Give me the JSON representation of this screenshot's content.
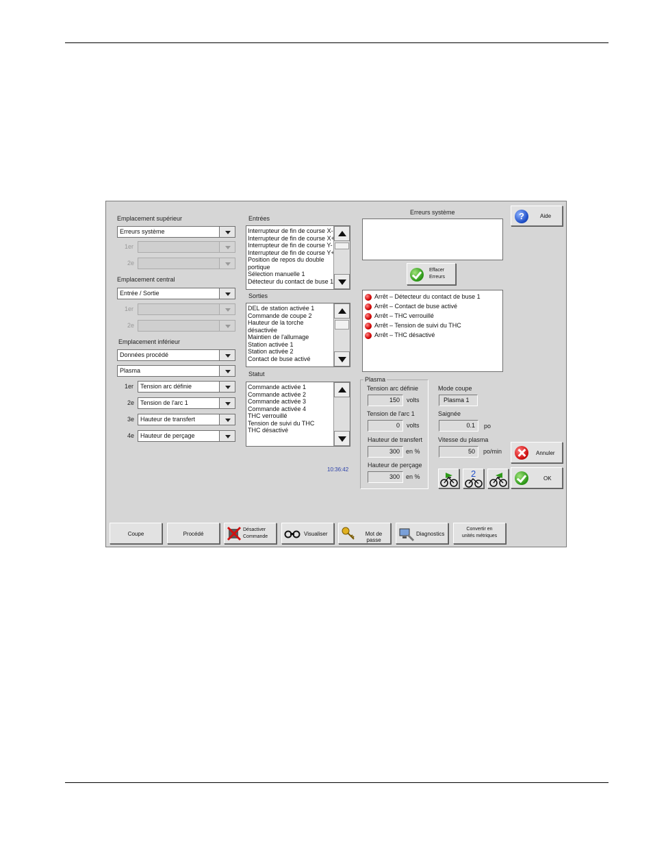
{
  "colors": {
    "panel_bg": "#d6d6d6",
    "time_text": "#2a3fa8",
    "error_dot": "#d00000",
    "accent_green": "#2f9a1a",
    "accent_red": "#d01010",
    "accent_blue": "#1f4fc8"
  },
  "left": {
    "upper_location": {
      "label": "Emplacement supérieur",
      "value": "Erreurs système",
      "sub1_label": "1er",
      "sub2_label": "2e"
    },
    "center_location": {
      "label": "Emplacement central",
      "value": "Entrée / Sortie",
      "sub1_label": "1er",
      "sub2_label": "2e"
    },
    "lower_location": {
      "label": "Emplacement inférieur",
      "value": "Données procédé",
      "process": "Plasma",
      "rows": [
        {
          "label": "1er",
          "value": "Tension arc définie"
        },
        {
          "label": "2e",
          "value": "Tension de l'arc 1"
        },
        {
          "label": "3e",
          "value": "Hauteur de transfert"
        },
        {
          "label": "4e",
          "value": "Hauteur de perçage"
        }
      ]
    }
  },
  "middle": {
    "inputs": {
      "label": "Entrées",
      "items": [
        "Interrupteur de fin de course X-",
        "Interrupteur de fin de course X+",
        "Interrupteur de fin de course Y-",
        "Interrupteur de fin de course Y+",
        "Position de repos du double",
        "portique",
        "Sélection manuelle 1",
        "Détecteur du contact de buse 1"
      ]
    },
    "outputs": {
      "label": "Sorties",
      "items": [
        "DEL de station activée 1",
        "Commande de coupe 2",
        "Hauteur de la torche",
        "désactivée",
        "Maintien de l'allumage",
        "Station activée 1",
        "Station activée 2",
        "Contact de buse activé"
      ]
    },
    "status": {
      "label": "Statut",
      "items": [
        "Commande activée 1",
        "Commande activée 2",
        "Commande activée 3",
        "Commande activée 4",
        "THC verrouillé",
        "Tension de suivi du THC",
        "THC désactivé"
      ]
    },
    "time": "10:36:42"
  },
  "right": {
    "system_errors_title": "Erreurs système",
    "clear_errors": {
      "line1": "Effacer",
      "line2": "Erreurs"
    },
    "error_list": [
      "Arrêt – Détecteur du contact de buse 1",
      "Arrêt – Contact de buse activé",
      "Arrêt – THC verrouillé",
      "Arrêt – Tension de suivi du THC",
      "Arrêt – THC désactivé"
    ],
    "plasma": {
      "title": "Plasma",
      "fields": [
        {
          "label": "Tension arc définie",
          "value": "150",
          "unit": "volts"
        },
        {
          "label": "Tension de l'arc 1",
          "value": "0",
          "unit": "volts"
        },
        {
          "label": "Hauteur de transfert",
          "value": "300",
          "unit": "en %"
        },
        {
          "label": "Hauteur de perçage",
          "value": "300",
          "unit": "en %"
        }
      ]
    },
    "cut_mode": {
      "label": "Mode coupe",
      "value": "Plasma 1"
    },
    "kerf": {
      "label": "Saignée",
      "value": "0.1",
      "unit": "po"
    },
    "plasma_speed": {
      "label": "Vitesse du plasma",
      "value": "50",
      "unit": "po/min"
    },
    "help_label": "Aide",
    "cancel_label": "Annuler",
    "ok_label": "OK",
    "speed_button_2_number": "2"
  },
  "toolbar": {
    "cut": "Coupe",
    "process": "Procédé",
    "disable_line1": "Désactiver",
    "disable_line2": "Commande",
    "view": "Visualiser",
    "password": "Mot de passe",
    "diagnostics": "Diagnostics",
    "convert_line1": "Convertir en",
    "convert_line2": "unités métriques"
  }
}
